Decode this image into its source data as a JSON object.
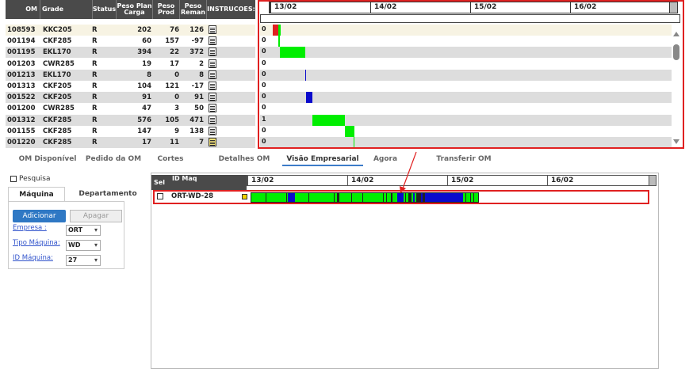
{
  "om_table": {
    "headers": {
      "om": "OM",
      "grade": "Grade",
      "status": "Status",
      "plan": "Peso Plan Carga",
      "prod": "Peso Prod",
      "rem": "Peso Reman",
      "ins": "INSTRUCOES:"
    },
    "rows": [
      {
        "om": "108593",
        "grade": "KKC205",
        "status": "R",
        "plan": "202",
        "prod": "76",
        "rem": "126"
      },
      {
        "om": "001194",
        "grade": "CKF285",
        "status": "R",
        "plan": "60",
        "prod": "157",
        "rem": "-97"
      },
      {
        "om": "001195",
        "grade": "EKL170",
        "status": "R",
        "plan": "394",
        "prod": "22",
        "rem": "372"
      },
      {
        "om": "001203",
        "grade": "CWR285",
        "status": "R",
        "plan": "19",
        "prod": "17",
        "rem": "2"
      },
      {
        "om": "001213",
        "grade": "EKL170",
        "status": "R",
        "plan": "8",
        "prod": "0",
        "rem": "8"
      },
      {
        "om": "001313",
        "grade": "CKF205",
        "status": "R",
        "plan": "104",
        "prod": "121",
        "rem": "-17"
      },
      {
        "om": "001522",
        "grade": "CKF205",
        "status": "R",
        "plan": "91",
        "prod": "0",
        "rem": "91"
      },
      {
        "om": "001200",
        "grade": "CWR285",
        "status": "R",
        "plan": "47",
        "prod": "3",
        "rem": "50"
      },
      {
        "om": "001312",
        "grade": "CKF285",
        "status": "R",
        "plan": "576",
        "prod": "105",
        "rem": "471"
      },
      {
        "om": "001155",
        "grade": "CKF285",
        "status": "R",
        "plan": "147",
        "prod": "9",
        "rem": "138"
      },
      {
        "om": "001220",
        "grade": "CKF285",
        "status": "R",
        "plan": "17",
        "prod": "11",
        "rem": "7"
      }
    ]
  },
  "top_gantt": {
    "dates": [
      "13/02",
      "14/02",
      "15/02",
      "16/02"
    ],
    "row_labels": [
      "0",
      "0",
      "0",
      "0",
      "0",
      "0",
      "0",
      "0",
      "1",
      "0",
      "0"
    ]
  },
  "tabs": [
    "OM Disponível",
    "Pedido da OM",
    "Cortes",
    "Detalhes OM",
    "Visão Empresarial",
    "Agora",
    "Transferir OM"
  ],
  "active_tab": "Visão Empresarial",
  "search": {
    "pesquisa_label": "Pesquisa",
    "subtabs": [
      "Máquina",
      "Departamento"
    ],
    "add_label": "Adicionar",
    "delete_label": "Apagar",
    "fields": [
      {
        "label": "Empresa :",
        "value": "ORT"
      },
      {
        "label": "Tipo Máquina:",
        "value": "WD"
      },
      {
        "label": "ID Máquina:",
        "value": "27"
      }
    ]
  },
  "enterprise_view": {
    "sel_label": "Sel",
    "id_label": "ID Maq",
    "dates": [
      "13/02",
      "14/02",
      "15/02",
      "16/02"
    ],
    "machine": "ORT-WD-28"
  },
  "colors": {
    "green": "#00ee00",
    "blue": "#0a0acc",
    "red": "#e02020",
    "header": "#4a4a4a",
    "accent": "#3d7cc9"
  }
}
